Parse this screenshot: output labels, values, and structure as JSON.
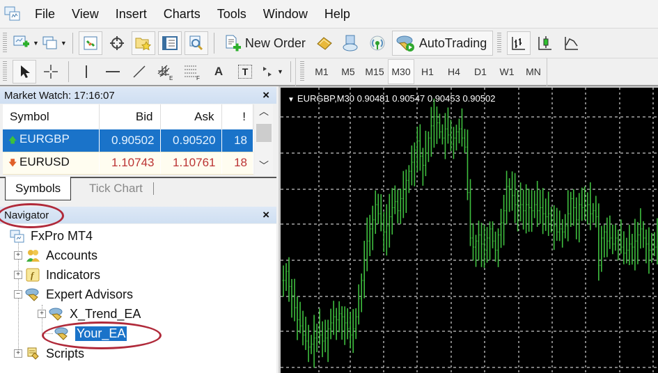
{
  "menu": [
    "File",
    "View",
    "Insert",
    "Charts",
    "Tools",
    "Window",
    "Help"
  ],
  "toolbar1": {
    "new_order_label": "New Order",
    "autotrading_label": "AutoTrading",
    "icons": [
      "new-chart-icon",
      "profiles-icon",
      "market-watch-icon",
      "data-window-icon",
      "navigator-icon",
      "terminal-icon",
      "strategy-tester-icon",
      "new-order-icon",
      "metaeditor-icon",
      "market-icon",
      "signals-icon",
      "autotrading-icon",
      "bar-chart-icon",
      "candlestick-icon",
      "line-chart-icon"
    ]
  },
  "toolbar2": {
    "tools": [
      "cursor-icon",
      "crosshair-icon",
      "vertical-line-icon",
      "horizontal-line-icon",
      "trendline-icon",
      "equidistant-channel-icon",
      "fibonacci-icon",
      "text-icon",
      "text-label-icon",
      "arrows-icon"
    ],
    "text_tool_glyph": "A",
    "text_label_glyph": "T",
    "timeframes": [
      "M1",
      "M5",
      "M15",
      "M30",
      "H1",
      "H4",
      "D1",
      "W1",
      "MN"
    ],
    "active_timeframe": "M30"
  },
  "market_watch": {
    "title": "Market Watch: 17:16:07",
    "close": "×",
    "columns": [
      "Symbol",
      "Bid",
      "Ask",
      "!"
    ],
    "rows": [
      {
        "symbol": "EURGBP",
        "bid": "0.90502",
        "ask": "0.90520",
        "spread": "18",
        "direction": "up",
        "selected": true
      },
      {
        "symbol": "EURUSD",
        "bid": "1.10743",
        "ask": "1.10761",
        "spread": "18",
        "direction": "down",
        "selected": false
      }
    ],
    "tabs": [
      "Symbols",
      "Tick Chart"
    ],
    "active_tab": "Symbols"
  },
  "navigator": {
    "title": "Navigator",
    "close": "×",
    "root": "FxPro MT4",
    "items": [
      {
        "label": "Accounts",
        "expander": "+",
        "icon": "accounts-icon"
      },
      {
        "label": "Indicators",
        "expander": "+",
        "icon": "indicators-icon"
      },
      {
        "label": "Expert Advisors",
        "expander": "−",
        "icon": "expert-advisor-icon"
      },
      {
        "label": "X_Trend_EA",
        "expander": "+",
        "icon": "expert-advisor-icon",
        "child": true
      },
      {
        "label": "Your_EA",
        "expander": "",
        "icon": "expert-advisor-icon",
        "child": true,
        "selected": true
      },
      {
        "label": "Scripts",
        "expander": "+",
        "icon": "scripts-icon"
      }
    ]
  },
  "chart": {
    "symbol": "EURGBP",
    "timeframe": "M30",
    "header": "EURGBP,M30  0.90481 0.90547 0.90453 0.90502",
    "ohlc": {
      "open": "0.90481",
      "high": "0.90547",
      "low": "0.90453",
      "close": "0.90502"
    },
    "bar_color": "#3fbf3f",
    "background": "#000000",
    "grid_color": "#c8c8c8"
  },
  "chart_data": {
    "type": "bar",
    "title": "EURGBP,M30",
    "series": [
      {
        "name": "EURGBP close (approx.)",
        "values": [
          0.9031,
          0.9034,
          0.9029,
          0.9026,
          0.9022,
          0.9018,
          0.9016,
          0.9013,
          0.9011,
          0.9009,
          0.901,
          0.9012,
          0.9014,
          0.9013,
          0.9011,
          0.9012,
          0.9015,
          0.9017,
          0.9019,
          0.9018,
          0.902,
          0.9019,
          0.9017,
          0.9015,
          0.9013,
          0.9015,
          0.9019,
          0.9025,
          0.9031,
          0.9038,
          0.9044,
          0.9048,
          0.9051,
          0.9056,
          0.9053,
          0.905,
          0.9047,
          0.9049,
          0.9052,
          0.9055,
          0.9057,
          0.9054,
          0.9058,
          0.9061,
          0.9064,
          0.9067,
          0.907,
          0.9074,
          0.9077,
          0.9072,
          0.9069,
          0.9073,
          0.9078,
          0.9082,
          0.9085,
          0.9083,
          0.908,
          0.9078,
          0.9081,
          0.9079,
          0.9076,
          0.9078,
          0.908,
          0.9081,
          0.9078,
          0.9075,
          0.906,
          0.9045,
          0.9042,
          0.9044,
          0.9046,
          0.9043,
          0.9041,
          0.9045,
          0.9048,
          0.9044,
          0.9041,
          0.9046,
          0.905,
          0.9054,
          0.9062,
          0.9061,
          0.9059,
          0.9056,
          0.9055,
          0.9056,
          0.9054,
          0.9056,
          0.9055,
          0.9054,
          0.9056,
          0.9054,
          0.9055,
          0.9053,
          0.9052,
          0.9053,
          0.9051,
          0.9049,
          0.9047,
          0.9048,
          0.9047,
          0.9049,
          0.9053,
          0.9058,
          0.9055,
          0.9051,
          0.9056,
          0.9055,
          0.9054,
          0.9056,
          0.9053,
          0.9054,
          0.9052,
          0.9036,
          0.9045,
          0.9047,
          0.9044,
          0.9045,
          0.9043,
          0.9045,
          0.9044,
          0.9042,
          0.904,
          0.9041,
          0.9043,
          0.9042,
          0.9044,
          0.9046,
          0.9048,
          0.9045,
          0.9043,
          0.9041,
          0.9043,
          0.9042,
          0.9044,
          0.9043
        ]
      }
    ],
    "ylim": [
      0.9,
      0.909
    ],
    "xlabel": "",
    "ylabel": "",
    "grid": true,
    "grid_style": "dashed"
  }
}
